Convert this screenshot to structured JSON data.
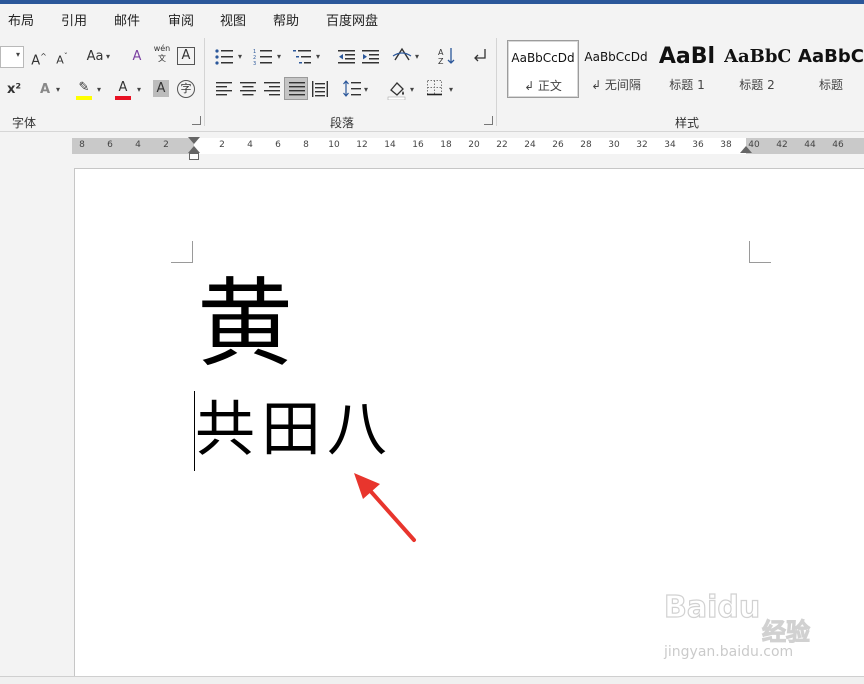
{
  "menu": {
    "items": [
      "布局",
      "引用",
      "邮件",
      "审阅",
      "视图",
      "帮助",
      "百度网盘"
    ]
  },
  "ribbon": {
    "font_group": {
      "label": "字体",
      "grow_label": "A",
      "shrink_label": "A",
      "case_label": "Aa",
      "clear_format_label": "A",
      "phonetic_label": "wén",
      "phonetic_sub": "文",
      "border_char": "A",
      "superscript": "x²",
      "effects": "A",
      "highlight": "✎",
      "font_color": "A",
      "shading_char": "A",
      "enclose_char": "字"
    },
    "paragraph_group": {
      "label": "段落"
    },
    "styles_group": {
      "label": "样式",
      "items": [
        {
          "preview": "AaBbCcDd",
          "name": "↲ 正文"
        },
        {
          "preview": "AaBbCcDd",
          "name": "↲ 无间隔"
        },
        {
          "preview": "AaBl",
          "name": "标题 1"
        },
        {
          "preview": "AaBbC",
          "name": "标题 2"
        },
        {
          "preview": "AaBbC",
          "name": "标题"
        }
      ]
    }
  },
  "ruler": {
    "left_numbers": [
      "8",
      "6",
      "4",
      "2"
    ],
    "right_numbers": [
      "2",
      "4",
      "6",
      "8",
      "10",
      "12",
      "14",
      "16",
      "18",
      "20",
      "22",
      "24",
      "26",
      "28",
      "30",
      "32",
      "34",
      "36",
      "38",
      "40",
      "42",
      "44",
      "46"
    ]
  },
  "document": {
    "big_char": "黄",
    "sub_chars": "共田八"
  },
  "watermark": {
    "logo": "Baidu",
    "cn": "经验",
    "url": "jingyan.baidu.com"
  },
  "colors": {
    "title_bar": "#2b579a",
    "highlight_yellow": "#ffff00",
    "font_color_red": "#e81123",
    "arrow_red": "#e8352d"
  }
}
